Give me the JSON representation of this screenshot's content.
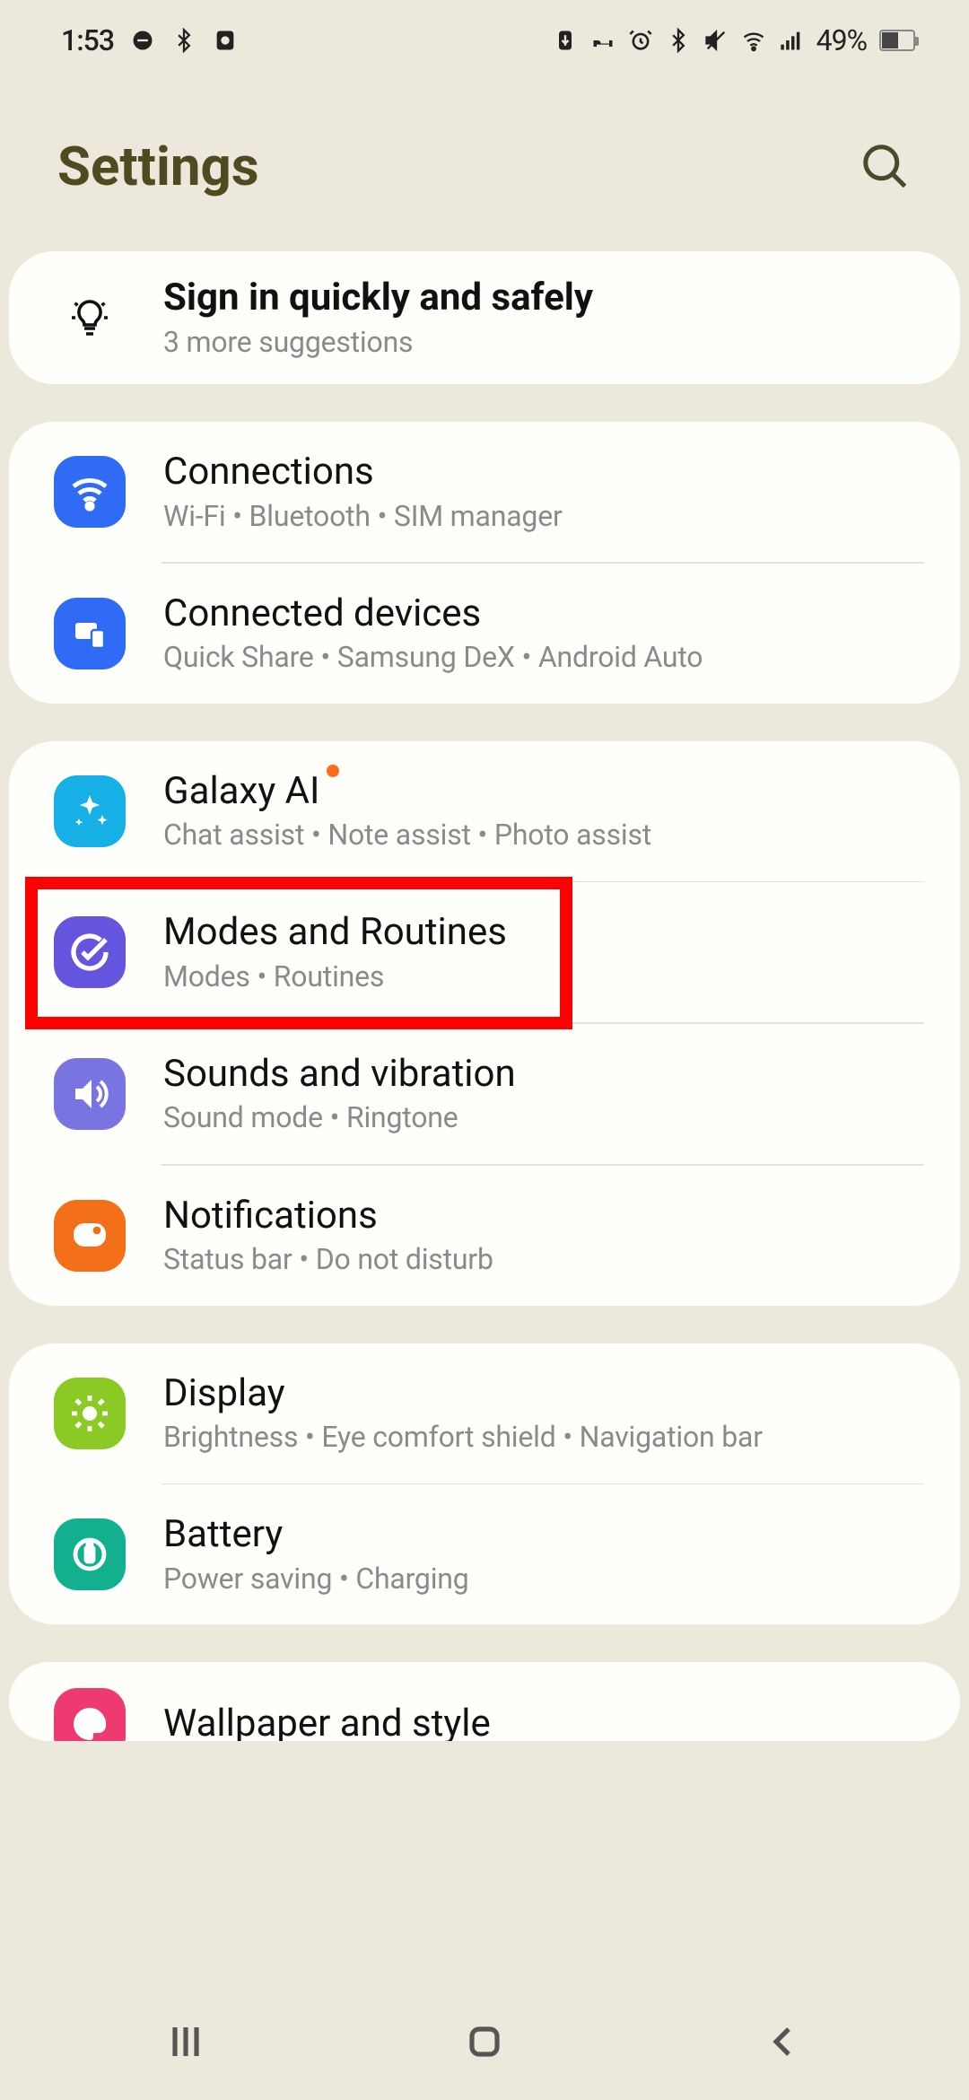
{
  "statusbar": {
    "time": "1:53",
    "battery_text": "49%"
  },
  "header": {
    "title": "Settings"
  },
  "suggestion": {
    "title": "Sign in quickly and safely",
    "subtitle": "3 more suggestions"
  },
  "groups": [
    {
      "items": [
        {
          "id": "connections",
          "title": "Connections",
          "subtitle": "Wi-Fi  •  Bluetooth  •  SIM manager",
          "iconColor": "blue"
        },
        {
          "id": "connected-devices",
          "title": "Connected devices",
          "subtitle": "Quick Share  •  Samsung DeX  •  Android Auto",
          "iconColor": "blue"
        }
      ]
    },
    {
      "items": [
        {
          "id": "galaxy-ai",
          "title": "Galaxy AI",
          "subtitle": "Chat assist  •  Note assist  •  Photo assist",
          "iconColor": "cyan",
          "badge": true
        },
        {
          "id": "modes-routines",
          "title": "Modes and Routines",
          "subtitle": "Modes  •  Routines",
          "iconColor": "purple",
          "highlight": true
        },
        {
          "id": "sounds-vibration",
          "title": "Sounds and vibration",
          "subtitle": "Sound mode  •  Ringtone",
          "iconColor": "pviolet"
        },
        {
          "id": "notifications",
          "title": "Notifications",
          "subtitle": "Status bar  •  Do not disturb",
          "iconColor": "orange"
        }
      ]
    },
    {
      "items": [
        {
          "id": "display",
          "title": "Display",
          "subtitle": "Brightness  •  Eye comfort shield  •  Navigation bar",
          "iconColor": "green"
        },
        {
          "id": "battery",
          "title": "Battery",
          "subtitle": "Power saving  •  Charging",
          "iconColor": "teal"
        }
      ]
    },
    {
      "items": [
        {
          "id": "wallpaper-style",
          "title": "Wallpaper and style",
          "subtitle": "",
          "iconColor": "pink"
        }
      ]
    }
  ]
}
